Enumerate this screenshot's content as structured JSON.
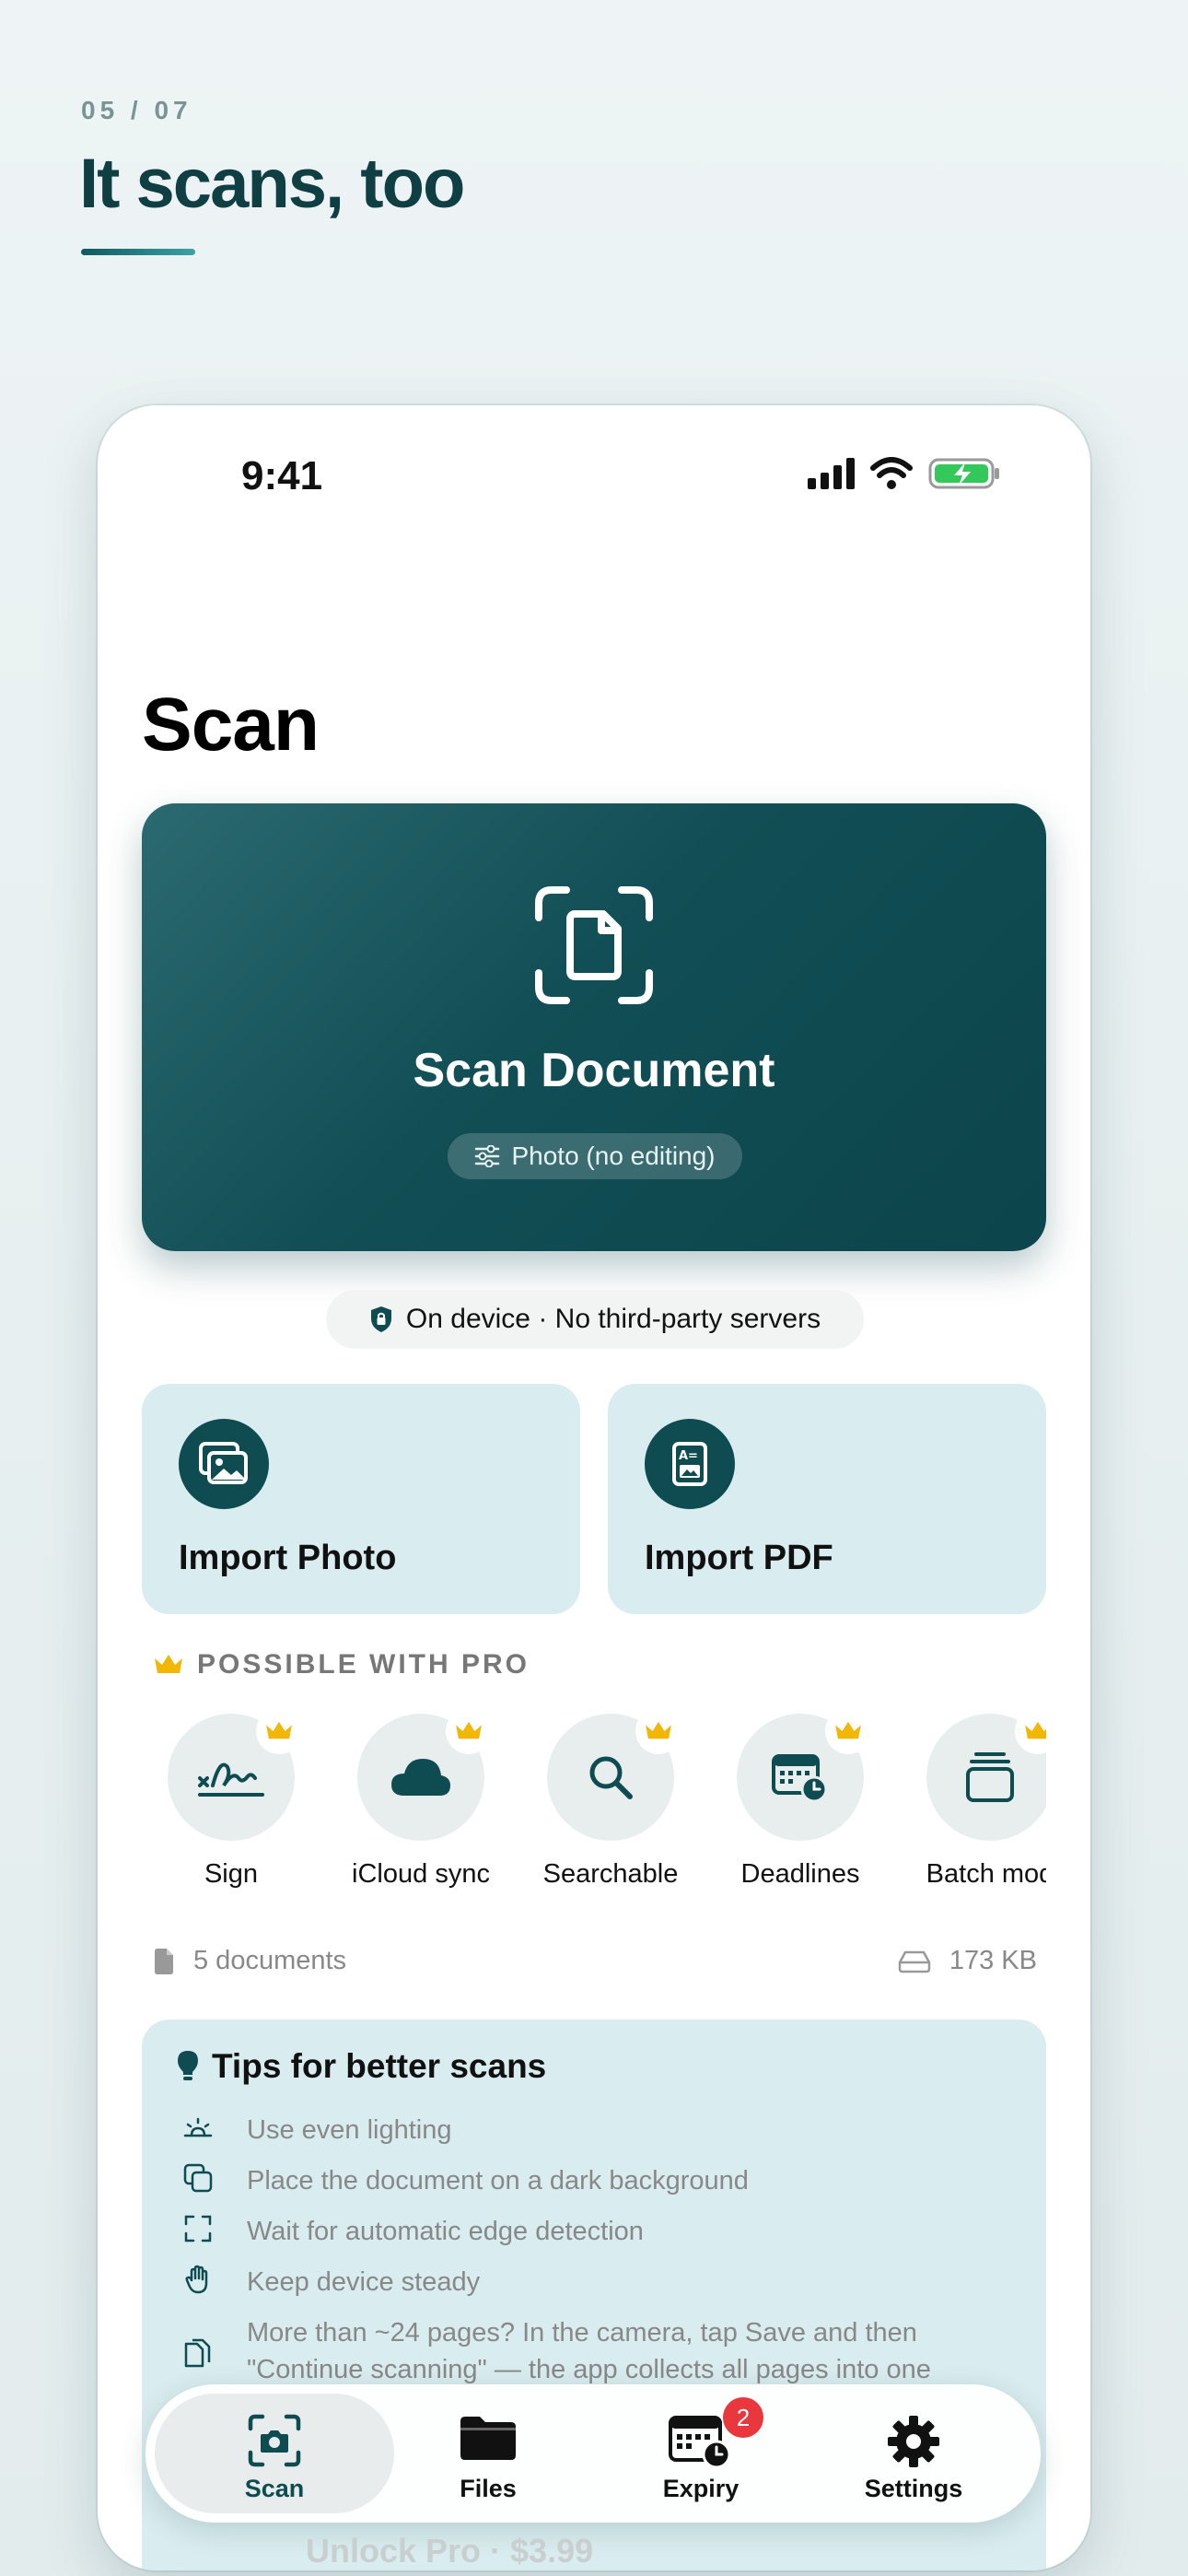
{
  "hero": {
    "counter": "05 / 07",
    "title": "It scans, too"
  },
  "status_bar": {
    "time": "9:41"
  },
  "screen": {
    "title": "Scan"
  },
  "scan_card": {
    "title": "Scan Document",
    "mode_chip": "Photo (no editing)"
  },
  "privacy": {
    "label": "On device · No third-party servers"
  },
  "imports": [
    {
      "label": "Import Photo",
      "icon": "photo-stack-icon"
    },
    {
      "label": "Import PDF",
      "icon": "pdf-document-icon"
    }
  ],
  "pro": {
    "header": "POSSIBLE WITH PRO",
    "features": [
      {
        "label": "Sign",
        "icon": "signature-icon"
      },
      {
        "label": "iCloud sync",
        "icon": "cloud-icon"
      },
      {
        "label": "Searchable",
        "icon": "magnifier-icon"
      },
      {
        "label": "Deadlines",
        "icon": "calendar-clock-icon"
      },
      {
        "label": "Batch mod",
        "icon": "stack-icon"
      }
    ]
  },
  "stats": {
    "documents": "5 documents",
    "storage": "173 KB"
  },
  "tips": {
    "title": "Tips for better scans",
    "items": [
      {
        "text": "Use even lighting",
        "icon": "light-icon"
      },
      {
        "text": "Place the document on a dark background",
        "icon": "copy-icon"
      },
      {
        "text": "Wait for automatic edge detection",
        "icon": "corners-icon"
      },
      {
        "text": "Keep device steady",
        "icon": "hand-icon"
      },
      {
        "text": "More than ~24 pages? In the camera, tap Save and then \"Continue scanning\" — the app collects all pages into one",
        "icon": "pages-icon"
      }
    ]
  },
  "tabs": [
    {
      "label": "Scan",
      "active": true
    },
    {
      "label": "Files",
      "active": false
    },
    {
      "label": "Expiry",
      "active": false,
      "badge": "2"
    },
    {
      "label": "Settings",
      "active": false
    }
  ],
  "footer": {
    "unlock": "Unlock Pro · $3.99"
  },
  "colors": {
    "accent": "#0f4c52",
    "tile_bg": "#d9ecef",
    "badge": "#e8383d",
    "crown": "#f2b705"
  }
}
